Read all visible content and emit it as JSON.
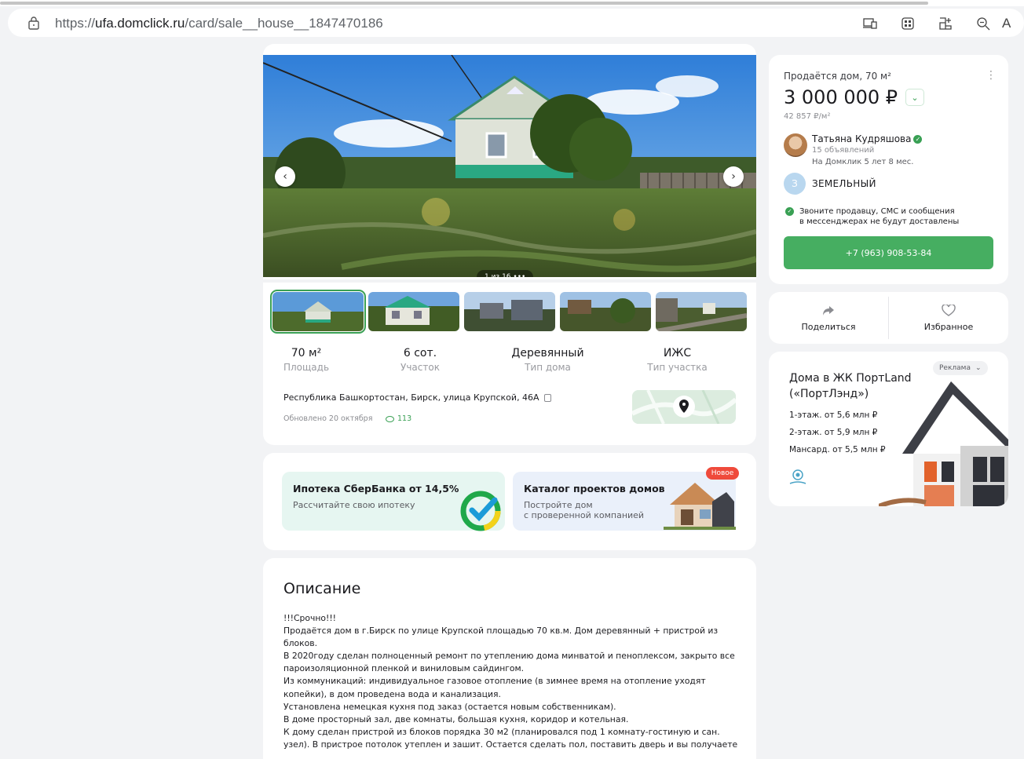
{
  "browser": {
    "url_prefix": "https://",
    "url_host": "ufa.domclick.ru",
    "url_path": "/card/sale__house__1847470186",
    "reader_label": "A"
  },
  "gallery": {
    "counter": "1 из 16  •••",
    "thumbs_count": 5
  },
  "stats": [
    {
      "value": "70 м²",
      "label": "Площадь"
    },
    {
      "value": "6 сот.",
      "label": "Участок"
    },
    {
      "value": "Деревянный",
      "label": "Тип дома"
    },
    {
      "value": "ИЖС",
      "label": "Тип участка"
    }
  ],
  "listing": {
    "address": "Республика Башкортостан, Бирск, улица Крупской, 46А",
    "updated": "Обновлено 20 октября",
    "views": "113"
  },
  "promos": {
    "mortgage_title": "Ипотека СберБанка от 14,5%",
    "mortgage_sub": "Рассчитайте свою ипотеку",
    "catalog_title": "Каталог проектов домов",
    "catalog_sub_1": "Постройте дом",
    "catalog_sub_2": "с проверенной компанией",
    "badge": "Новое"
  },
  "description": {
    "heading": "Описание",
    "lines": [
      "!!!Срочно!!!",
      "Продаётся дом в г.Бирск по улице Крупской площадью 70 кв.м. Дом деревянный + пристрой из",
      "блоков.",
      "В 2020году сделан полноценный ремонт по утеплению дома минватой и пеноплексом, закрыто все",
      "пароизоляционной пленкой и виниловым сайдингом.",
      "Из коммуникаций: индивидуальное газовое отопление (в зимнее время на отопление уходят",
      "копейки), в дом проведена вода и канализация.",
      "Установлена немецкая кухня под заказ (остается новым собственникам).",
      "В доме просторный зал, две комнаты, большая кухня, коридор и котельная.",
      "К дому сделан пристрой из блоков порядка 30 м2 (планировался под 1 комнату-гостиную и сан.",
      "узел). В пристрое потолок утеплен и зашит. Остается сделать пол, поставить дверь и вы получаете"
    ]
  },
  "sale": {
    "title": "Продаётся дом, 70 м²",
    "price": "3 000 000 ₽",
    "price_per_m2": "42 857 ₽/м²",
    "seller_name": "Татьяна Кудряшова",
    "seller_listings": "15 объявлений",
    "seller_since": "На Домклик 5 лет 8 мес.",
    "agency_initial": "З",
    "agency_name": "ЗЕМЕЛЬНЫЙ",
    "note_line1": "Звоните продавцу, СМС и сообщения",
    "note_line2": "в мессенджерах не будут доставлены",
    "phone": "+7 (963) 908-53-84"
  },
  "actions": {
    "share": "Поделиться",
    "favorite": "Избранное"
  },
  "ad": {
    "title_1": "Дома в ЖК ПортLand",
    "title_2": "(«ПортЛэнд»)",
    "line_1": "1-этаж. от 5,6 млн ₽",
    "line_2": "2-этаж. от 5,9 млн ₽",
    "line_3": "Мансард. от 5,5 млн ₽",
    "tag": "Реклама"
  },
  "colors": {
    "accent": "#46ae61",
    "badge": "#ef4a3b"
  }
}
